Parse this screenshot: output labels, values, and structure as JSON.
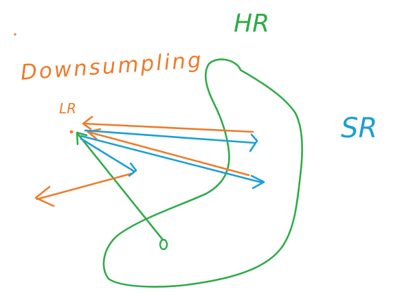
{
  "labels": {
    "hr": "HR",
    "sr": "SR",
    "downsampling": "Downsumpling",
    "lr": "LR"
  },
  "colors": {
    "hr": "#2eab47",
    "sr": "#1a9fd4",
    "downsampling": "#ee7a2a",
    "lr": "#ee7a2a",
    "background": "#ffffff"
  }
}
